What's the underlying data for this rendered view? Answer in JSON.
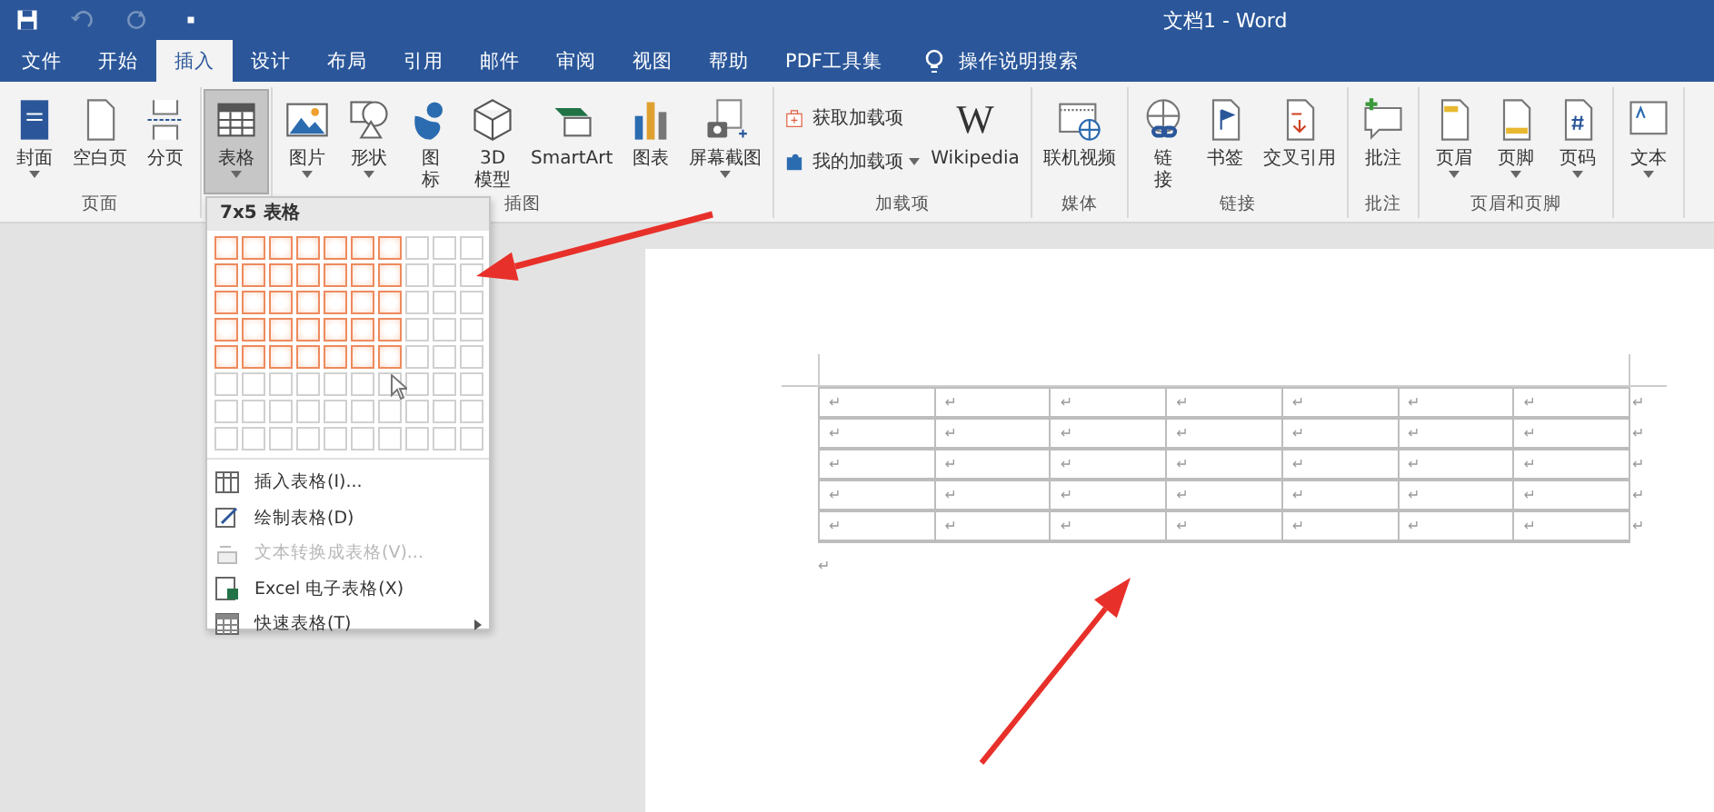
{
  "quick_access": [
    {
      "kind": "save",
      "disabled": false
    },
    {
      "kind": "undo",
      "disabled": true
    },
    {
      "kind": "redo",
      "disabled": true
    },
    {
      "kind": "customize",
      "disabled": false
    }
  ],
  "window": {
    "title": "文档1 - Word"
  },
  "tabs": [
    {
      "label": "文件",
      "selected": false
    },
    {
      "label": "开始",
      "selected": false
    },
    {
      "label": "插入",
      "selected": true
    },
    {
      "label": "设计",
      "selected": false
    },
    {
      "label": "布局",
      "selected": false
    },
    {
      "label": "引用",
      "selected": false
    },
    {
      "label": "邮件",
      "selected": false
    },
    {
      "label": "审阅",
      "selected": false
    },
    {
      "label": "视图",
      "selected": false
    },
    {
      "label": "帮助",
      "selected": false
    },
    {
      "label": "PDF工具集",
      "selected": false
    }
  ],
  "tell_me": {
    "placeholder": "操作说明搜索"
  },
  "ribbon": {
    "groups": [
      {
        "label": "页面",
        "buttons": [
          {
            "kind": "large",
            "lines": [
              "封面"
            ],
            "dropdown": true,
            "pressed": false
          },
          {
            "kind": "large",
            "lines": [
              "空白页"
            ],
            "dropdown": false,
            "pressed": false
          },
          {
            "kind": "large",
            "lines": [
              "分页"
            ],
            "dropdown": false,
            "pressed": false
          }
        ]
      },
      {
        "buttons": [
          {
            "kind": "large",
            "lines": [
              "表格"
            ],
            "dropdown": true,
            "pressed": true
          }
        ]
      },
      {
        "label": "插图",
        "buttons": [
          {
            "kind": "large",
            "lines": [
              "图片"
            ],
            "dropdown": true,
            "pressed": false
          },
          {
            "kind": "large",
            "lines": [
              "形状"
            ],
            "dropdown": true,
            "pressed": false
          },
          {
            "kind": "large",
            "lines": [
              "图",
              "标"
            ],
            "dropdown": false,
            "pressed": false
          },
          {
            "kind": "large",
            "lines": [
              "3D",
              "模型"
            ],
            "dropdown": false,
            "pressed": false
          },
          {
            "kind": "large",
            "lines": [
              "SmartArt"
            ],
            "dropdown": false,
            "pressed": false
          },
          {
            "kind": "large",
            "lines": [
              "图表"
            ],
            "dropdown": false,
            "pressed": false
          },
          {
            "kind": "large",
            "lines": [
              "屏幕截图"
            ],
            "dropdown": true,
            "pressed": false
          }
        ]
      },
      {
        "label": "加载项",
        "buttons": [
          {
            "kind": "small",
            "lines": [
              "获取加载项"
            ],
            "dropdown": false,
            "pressed": false
          },
          {
            "kind": "small",
            "lines": [
              "我的加载项"
            ],
            "dropdown": true,
            "pressed": false
          },
          {
            "kind": "large",
            "lines": [
              "Wikipedia"
            ],
            "logo_text": "W",
            "dropdown": false,
            "pressed": false
          }
        ]
      },
      {
        "label": "媒体",
        "buttons": [
          {
            "kind": "large",
            "lines": [
              "联机视频"
            ],
            "dropdown": false,
            "pressed": false
          }
        ]
      },
      {
        "label": "链接",
        "buttons": [
          {
            "kind": "large",
            "lines": [
              "链",
              "接"
            ],
            "dropdown": false,
            "pressed": false
          },
          {
            "kind": "large",
            "lines": [
              "书签"
            ],
            "dropdown": false,
            "pressed": false
          },
          {
            "kind": "large",
            "lines": [
              "交叉引用"
            ],
            "dropdown": false,
            "pressed": false
          }
        ]
      },
      {
        "label": "批注",
        "buttons": [
          {
            "kind": "large",
            "lines": [
              "批注"
            ],
            "dropdown": false,
            "pressed": false
          }
        ]
      },
      {
        "label": "页眉和页脚",
        "buttons": [
          {
            "kind": "large",
            "lines": [
              "页眉"
            ],
            "dropdown": true,
            "pressed": false
          },
          {
            "kind": "large",
            "lines": [
              "页脚"
            ],
            "dropdown": true,
            "pressed": false
          },
          {
            "kind": "large",
            "lines": [
              "页码"
            ],
            "dropdown": true,
            "pressed": false
          }
        ]
      },
      {
        "buttons": [
          {
            "kind": "large",
            "lines": [
              "文本"
            ],
            "dropdown": true,
            "pressed": false
          }
        ]
      }
    ]
  },
  "table_menu": {
    "title": "7x5 表格",
    "grid": [
      {
        "cells": [
          {
            "selected": true
          },
          {
            "selected": true
          },
          {
            "selected": true
          },
          {
            "selected": true
          },
          {
            "selected": true
          },
          {
            "selected": true
          },
          {
            "selected": true
          },
          {
            "selected": false
          },
          {
            "selected": false
          },
          {
            "selected": false
          }
        ]
      },
      {
        "cells": [
          {
            "selected": true
          },
          {
            "selected": true
          },
          {
            "selected": true
          },
          {
            "selected": true
          },
          {
            "selected": true
          },
          {
            "selected": true
          },
          {
            "selected": true
          },
          {
            "selected": false
          },
          {
            "selected": false
          },
          {
            "selected": false
          }
        ]
      },
      {
        "cells": [
          {
            "selected": true
          },
          {
            "selected": true
          },
          {
            "selected": true
          },
          {
            "selected": true
          },
          {
            "selected": true
          },
          {
            "selected": true
          },
          {
            "selected": true
          },
          {
            "selected": false
          },
          {
            "selected": false
          },
          {
            "selected": false
          }
        ]
      },
      {
        "cells": [
          {
            "selected": true
          },
          {
            "selected": true
          },
          {
            "selected": true
          },
          {
            "selected": true
          },
          {
            "selected": true
          },
          {
            "selected": true
          },
          {
            "selected": true
          },
          {
            "selected": false
          },
          {
            "selected": false
          },
          {
            "selected": false
          }
        ]
      },
      {
        "cells": [
          {
            "selected": true
          },
          {
            "selected": true
          },
          {
            "selected": true
          },
          {
            "selected": true
          },
          {
            "selected": true
          },
          {
            "selected": true
          },
          {
            "selected": true
          },
          {
            "selected": false
          },
          {
            "selected": false
          },
          {
            "selected": false
          }
        ]
      },
      {
        "cells": [
          {
            "selected": false
          },
          {
            "selected": false
          },
          {
            "selected": false
          },
          {
            "selected": false
          },
          {
            "selected": false
          },
          {
            "selected": false
          },
          {
            "selected": false
          },
          {
            "selected": false
          },
          {
            "selected": false
          },
          {
            "selected": false
          }
        ]
      },
      {
        "cells": [
          {
            "selected": false
          },
          {
            "selected": false
          },
          {
            "selected": false
          },
          {
            "selected": false
          },
          {
            "selected": false
          },
          {
            "selected": false
          },
          {
            "selected": false
          },
          {
            "selected": false
          },
          {
            "selected": false
          },
          {
            "selected": false
          }
        ]
      },
      {
        "cells": [
          {
            "selected": false
          },
          {
            "selected": false
          },
          {
            "selected": false
          },
          {
            "selected": false
          },
          {
            "selected": false
          },
          {
            "selected": false
          },
          {
            "selected": false
          },
          {
            "selected": false
          },
          {
            "selected": false
          },
          {
            "selected": false
          }
        ]
      }
    ],
    "items": [
      {
        "label": "插入表格(I)...",
        "disabled": false,
        "submenu": false
      },
      {
        "label": "绘制表格(D)",
        "disabled": false,
        "submenu": false
      },
      {
        "label": "文本转换成表格(V)...",
        "disabled": true,
        "submenu": false
      },
      {
        "label": "Excel 电子表格(X)",
        "disabled": false,
        "submenu": false
      },
      {
        "label": "快速表格(T)",
        "disabled": false,
        "submenu": true
      }
    ]
  },
  "document": {
    "table": {
      "rows": [
        {
          "cells": [
            "↵",
            "↵",
            "↵",
            "↵",
            "↵",
            "↵",
            "↵"
          ],
          "end_mark": "↵"
        },
        {
          "cells": [
            "↵",
            "↵",
            "↵",
            "↵",
            "↵",
            "↵",
            "↵"
          ],
          "end_mark": "↵"
        },
        {
          "cells": [
            "↵",
            "↵",
            "↵",
            "↵",
            "↵",
            "↵",
            "↵"
          ],
          "end_mark": "↵"
        },
        {
          "cells": [
            "↵",
            "↵",
            "↵",
            "↵",
            "↵",
            "↵",
            "↵"
          ],
          "end_mark": "↵"
        },
        {
          "cells": [
            "↵",
            "↵",
            "↵",
            "↵",
            "↵",
            "↵",
            "↵"
          ],
          "end_mark": "↵"
        }
      ]
    },
    "paragraph_mark": "↵"
  }
}
